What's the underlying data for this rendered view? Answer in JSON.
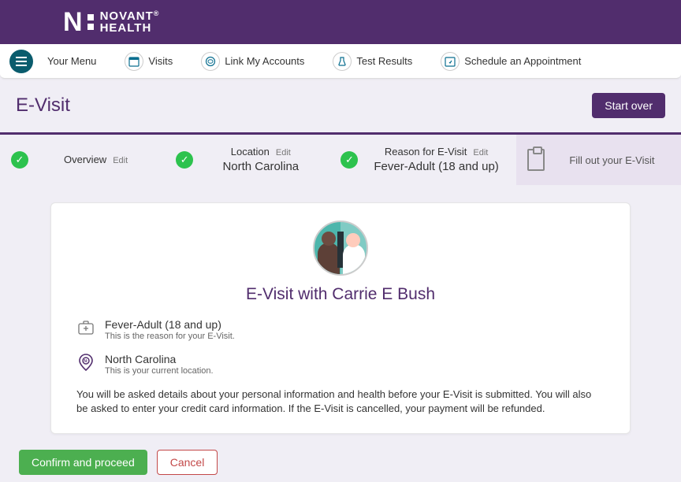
{
  "brand": {
    "novant": "NOVANT",
    "health": "HEALTH"
  },
  "nav": {
    "menu": "Your Menu",
    "visits": "Visits",
    "link": "Link My Accounts",
    "results": "Test Results",
    "schedule": "Schedule an Appointment"
  },
  "page": {
    "title": "E-Visit",
    "start_over": "Start over"
  },
  "stepper": {
    "overview": {
      "label": "Overview",
      "edit": "Edit"
    },
    "location": {
      "label": "Location",
      "edit": "Edit",
      "value": "North Carolina"
    },
    "reason": {
      "label": "Reason for E-Visit",
      "edit": "Edit",
      "value": "Fever-Adult (18 and up)"
    },
    "fillout": {
      "label": "Fill out your E-Visit"
    }
  },
  "card": {
    "title": "E-Visit with Carrie E Bush",
    "reason": {
      "main": "Fever-Adult (18 and up)",
      "sub": "This is the reason for your E-Visit."
    },
    "location": {
      "main": "North Carolina",
      "sub": "This is your current location."
    },
    "desc": "You will be asked details about your personal information and health before your E-Visit is submitted. You will also be asked to enter your credit card information. If the E-Visit is cancelled, your payment will be refunded."
  },
  "actions": {
    "confirm": "Confirm and proceed",
    "cancel": "Cancel"
  }
}
